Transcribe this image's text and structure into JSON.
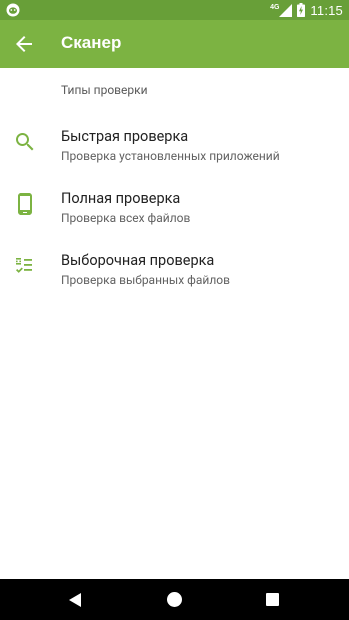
{
  "status_bar": {
    "network": "4G",
    "time": "11:15",
    "icons": [
      "app-notification-icon",
      "signal-icon",
      "battery-charging-icon"
    ]
  },
  "app_bar": {
    "title": "Сканер",
    "back_icon": "arrow-left-icon"
  },
  "section_header": "Типы проверки",
  "scan_types": [
    {
      "icon": "search-icon",
      "title": "Быстрая проверка",
      "subtitle": "Проверка установленных приложений"
    },
    {
      "icon": "smartphone-icon",
      "title": "Полная проверка",
      "subtitle": "Проверка всех файлов"
    },
    {
      "icon": "checklist-icon",
      "title": "Выборочная проверка",
      "subtitle": "Проверка выбранных файлов"
    }
  ],
  "nav_bar": {
    "icons": [
      "nav-back-icon",
      "nav-home-icon",
      "nav-recents-icon"
    ]
  },
  "colors": {
    "status_bar": "#689f38",
    "app_bar": "#7cb342",
    "accent_icon": "#7cb342",
    "title_text": "#212121",
    "subtitle_text": "#616161"
  }
}
